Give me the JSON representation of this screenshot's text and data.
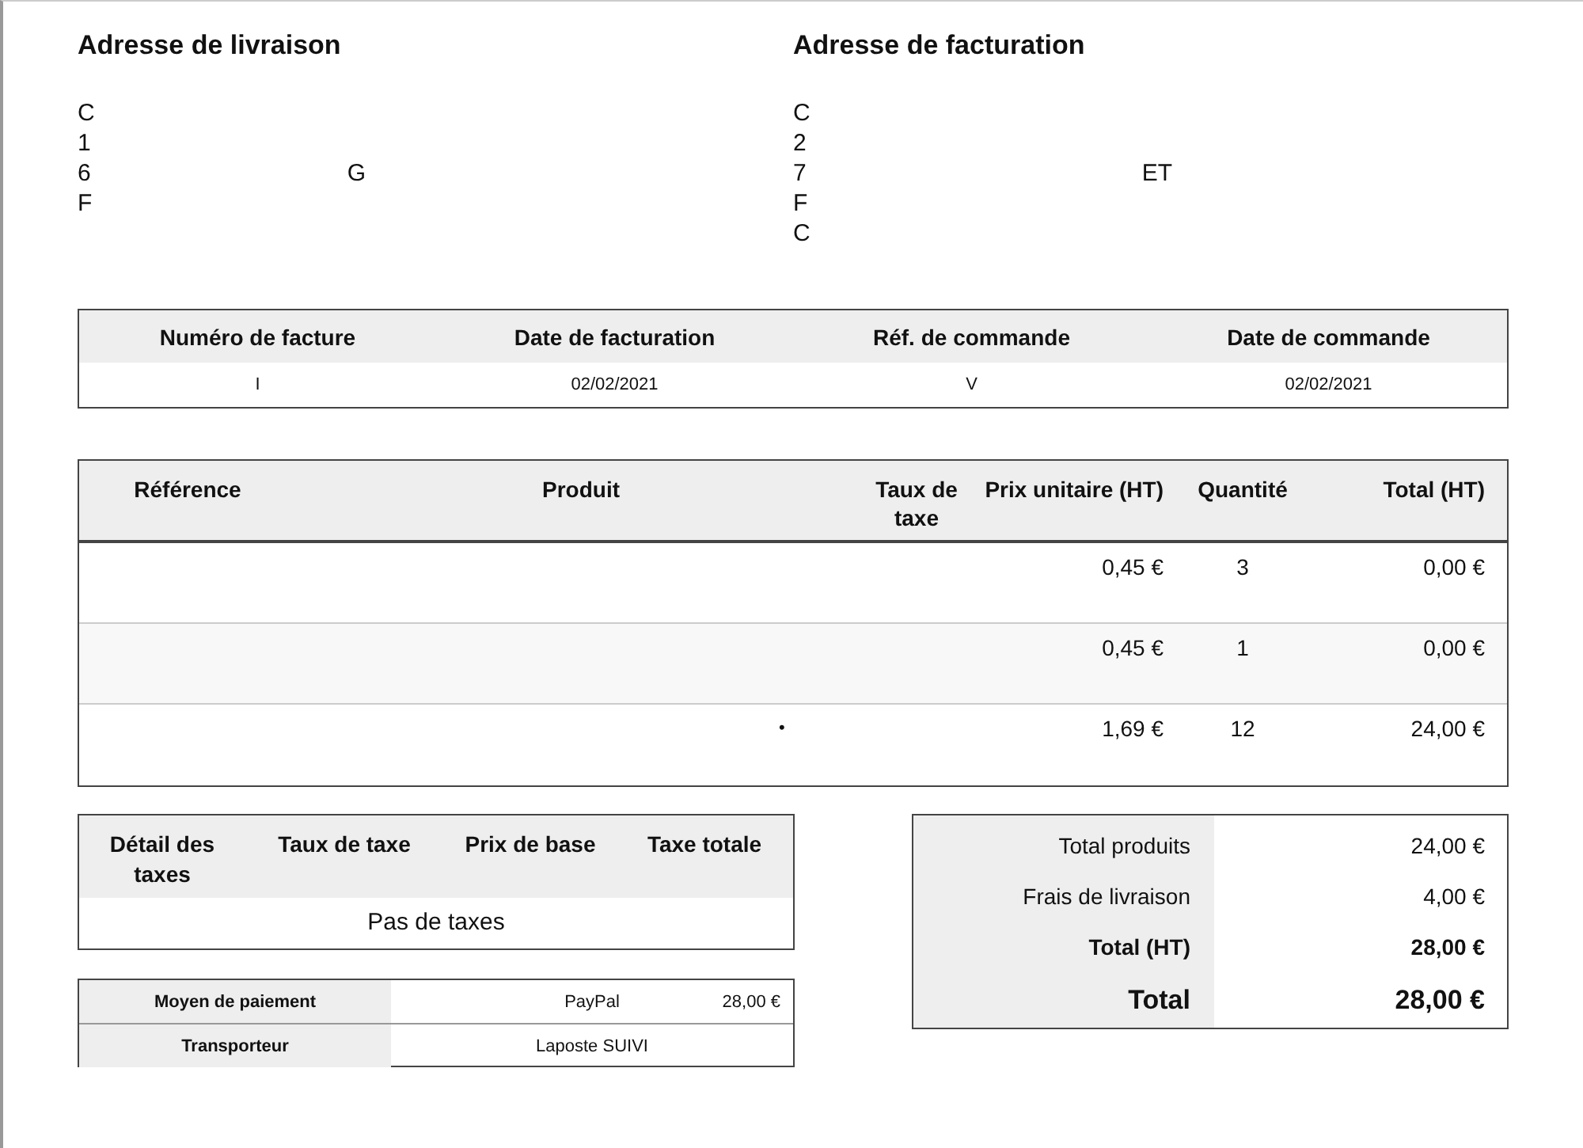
{
  "addresses": [
    {
      "title": "Adresse de livraison",
      "lines": [
        [
          "C"
        ],
        [
          "1"
        ],
        [
          "6",
          "G"
        ],
        [
          "F"
        ]
      ]
    },
    {
      "title": "Adresse de facturation",
      "lines": [
        [
          "C"
        ],
        [
          "2"
        ],
        [
          "7",
          "ET"
        ],
        [
          "F"
        ],
        [
          "C"
        ]
      ]
    }
  ],
  "invoice_info": {
    "columns": [
      "Numéro de facture",
      "Date de facturation",
      "Réf. de commande",
      "Date de commande"
    ],
    "values": [
      "I",
      "02/02/2021",
      "V",
      "02/02/2021"
    ]
  },
  "products": {
    "columns": [
      "Référence",
      "Produit",
      "Taux de taxe",
      "Prix unitaire (HT)",
      "Quantité",
      "Total (HT)"
    ],
    "rows": [
      {
        "product": "",
        "unit_price": "0,45 €",
        "quantity": "3",
        "total": "0,00 €"
      },
      {
        "product": "",
        "unit_price": "0,45 €",
        "quantity": "1",
        "total": "0,00 €"
      },
      {
        "product": "•",
        "unit_price": "1,69 €",
        "quantity": "12",
        "total": "24,00 €"
      }
    ]
  },
  "tax_details": {
    "columns": [
      "Détail des taxes",
      "Taux de taxe",
      "Prix de base",
      "Taxe totale"
    ],
    "empty_text": "Pas de taxes"
  },
  "payment": [
    {
      "label": "Moyen de paiement",
      "value": "PayPal",
      "amount": "28,00 €"
    },
    {
      "label": "Transporteur",
      "value": "Laposte SUIVI"
    }
  ],
  "totals": [
    {
      "label": "Total produits",
      "value": "24,00 €",
      "kind": "plain"
    },
    {
      "label": "Frais de livraison",
      "value": "4,00 €",
      "kind": "plain"
    },
    {
      "label": "Total (HT)",
      "value": "28,00 €",
      "kind": "bold"
    },
    {
      "label": "Total",
      "value": "28,00 €",
      "kind": "grand"
    }
  ]
}
